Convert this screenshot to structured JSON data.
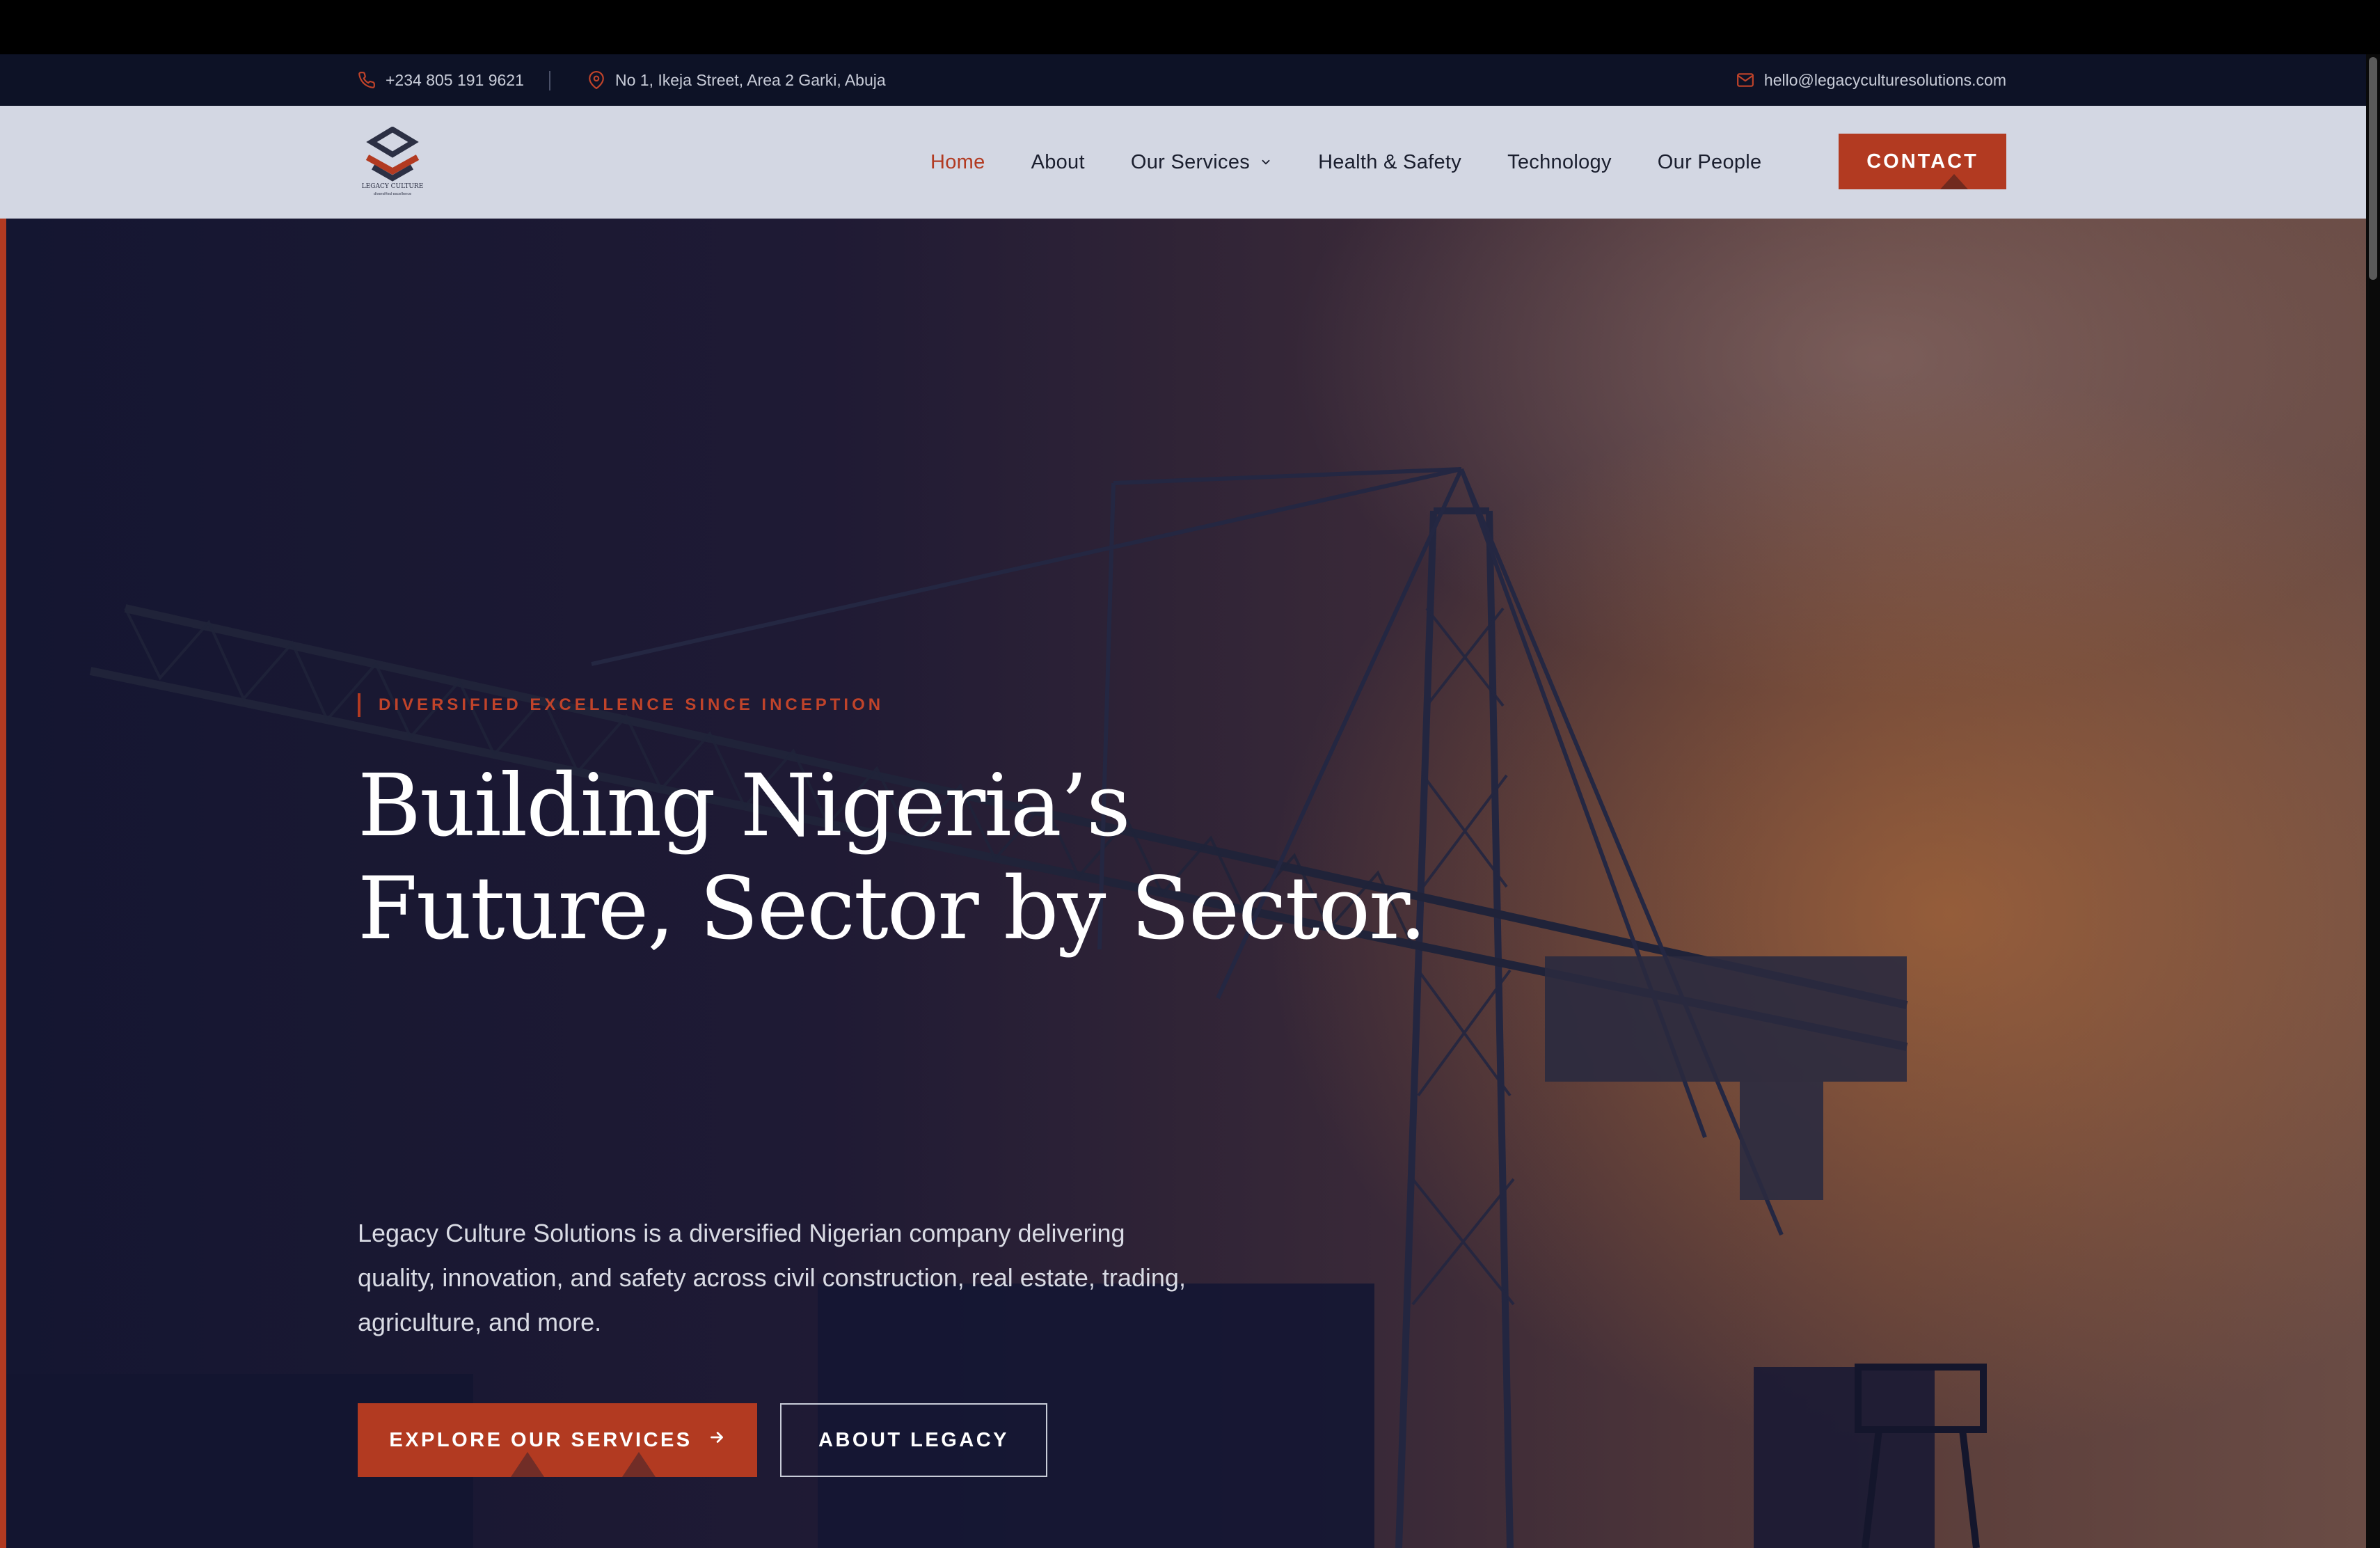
{
  "topbar": {
    "phone": "+234 805 191 9621",
    "address": "No 1, Ikeja Street, Area 2 Garki, Abuja",
    "email": "hello@legacyculturesolutions.com"
  },
  "brand": {
    "logo_text": "LEGACY CULTURE",
    "logo_tagline": "diversified excellence",
    "accent_color": "#b23a21",
    "dark_color": "#0d1226"
  },
  "nav": {
    "items": [
      {
        "label": "Home",
        "active": true
      },
      {
        "label": "About"
      },
      {
        "label": "Our Services",
        "has_dropdown": true
      },
      {
        "label": "Health & Safety"
      },
      {
        "label": "Technology"
      },
      {
        "label": "Our People"
      }
    ],
    "contact_label": "CONTACT"
  },
  "hero": {
    "eyebrow": "DIVERSIFIED EXCELLENCE SINCE INCEPTION",
    "headline_line1": "Building Nigeria’s",
    "headline_line2": "Future, Sector by Sector.",
    "intro": "Legacy Culture Solutions is a diversified Nigerian company delivering quality, innovation, and safety across civil construction, real estate, trading, agriculture, and more.",
    "primary_cta": "EXPLORE OUR SERVICES",
    "secondary_cta": "ABOUT LEGACY"
  },
  "icons": {
    "phone": "phone-icon",
    "address": "map-pin-icon",
    "email": "mail-icon",
    "dropdown": "chevron-down-icon",
    "cta_arrow": "arrow-right-icon"
  }
}
